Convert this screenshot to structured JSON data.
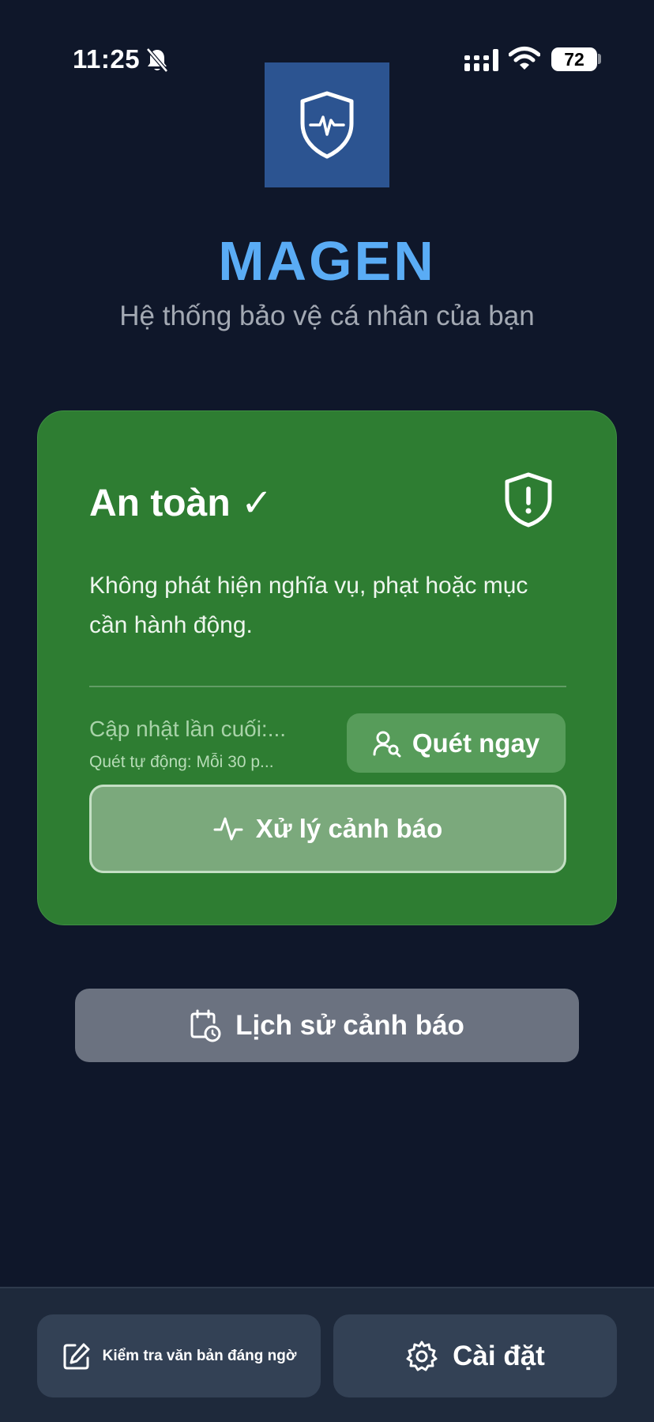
{
  "status_bar": {
    "time": "11:25",
    "battery_level": "72",
    "icons": [
      "bell-off-icon",
      "signal-icon",
      "wifi-icon",
      "battery-icon"
    ]
  },
  "header": {
    "logo_icon": "shield-heartbeat-icon",
    "title": "MAGEN",
    "subtitle": "Hệ thống bảo vệ cá nhân của bạn"
  },
  "status_card": {
    "heading": "An toàn ✓",
    "heading_icon": "shield-alert-icon",
    "message": "Không phát hiện nghĩa vụ, phạt hoặc mục cần hành động.",
    "last_updated": "Cập nhật lần cuối:...",
    "auto_scan": "Quét tự động: Mỗi 30 p...",
    "scan_button_label": "Quét ngay",
    "scan_button_icon": "user-search-icon",
    "handle_alert_label": "Xử lý cảnh báo",
    "handle_alert_icon": "activity-icon"
  },
  "history": {
    "label": "Lịch sử cảnh báo",
    "icon": "calendar-clock-icon"
  },
  "bottom_bar": {
    "check_text_label": "Kiểm tra văn bản đáng ngờ",
    "check_text_icon": "edit-icon",
    "settings_label": "Cài đặt",
    "settings_icon": "gear-icon"
  },
  "colors": {
    "background": "#0f172a",
    "card_green": "#2e7d32",
    "title_blue": "#5aacf5",
    "logo_blue": "#2c5491",
    "history_gray": "#6b7280",
    "bottom_button": "#334155"
  }
}
